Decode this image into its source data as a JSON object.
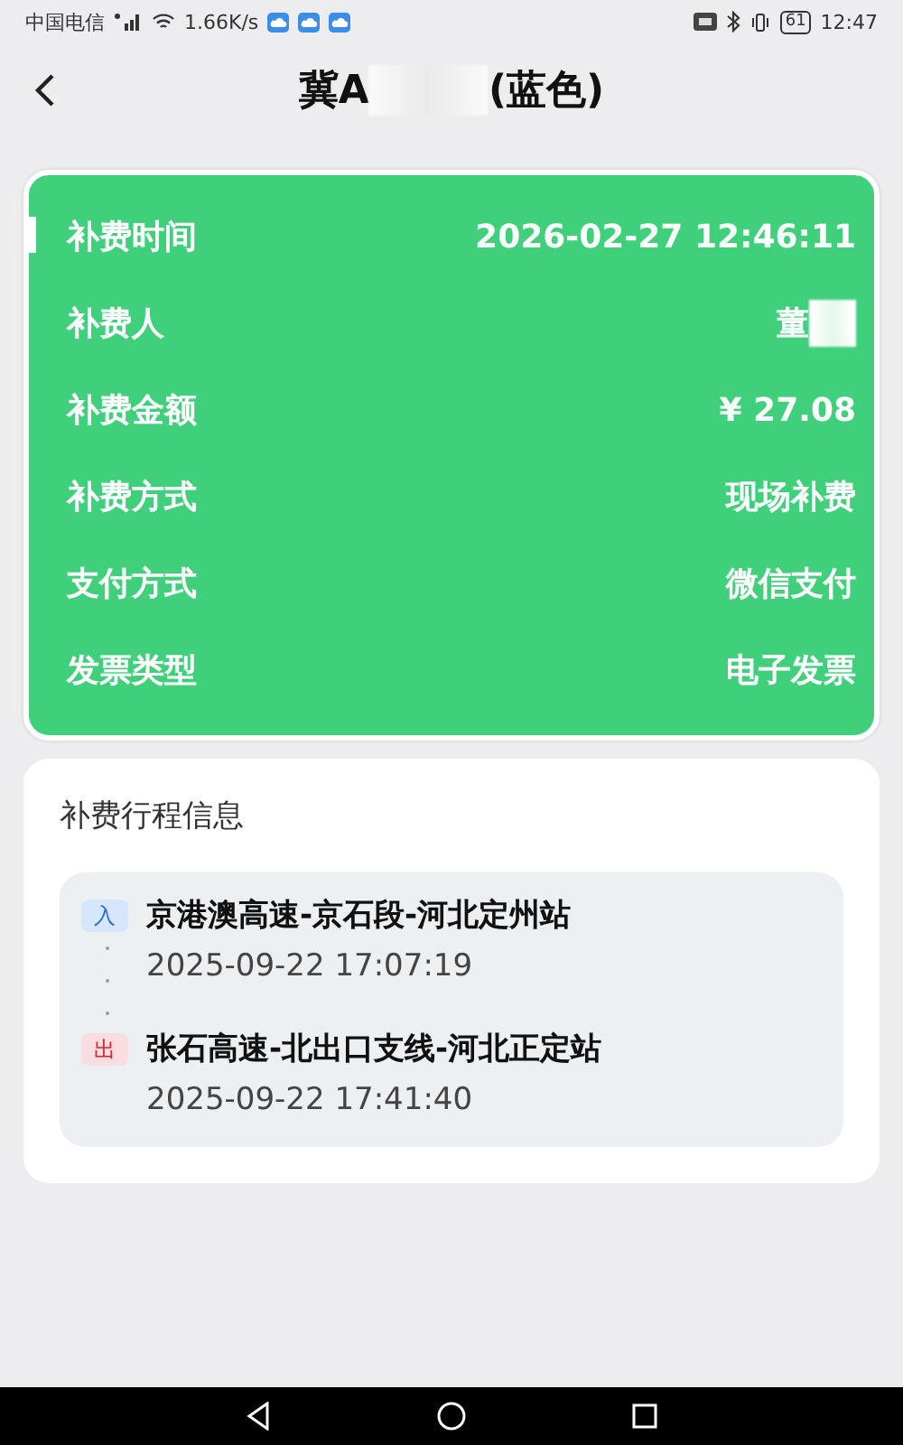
{
  "status_bar": {
    "carrier": "中国电信",
    "speed": "1.66K/s",
    "battery": "61",
    "time": "12:47"
  },
  "header": {
    "title_prefix": "冀A",
    "title_suffix": "(蓝色)",
    "title_masked": true
  },
  "summary": {
    "rows": [
      {
        "label": "补费时间",
        "value": "2026-02-27 12:46:11",
        "selected": true,
        "masked": false
      },
      {
        "label": "补费人",
        "value": "董",
        "selected": false,
        "masked": true
      },
      {
        "label": "补费金额",
        "value": "¥ 27.08",
        "selected": false,
        "masked": false
      },
      {
        "label": "补费方式",
        "value": "现场补费",
        "selected": false,
        "masked": false
      },
      {
        "label": "支付方式",
        "value": "微信支付",
        "selected": false,
        "masked": false
      },
      {
        "label": "发票类型",
        "value": "电子发票",
        "selected": false,
        "masked": false
      }
    ]
  },
  "trip": {
    "title": "补费行程信息",
    "stops": [
      {
        "kind": "entry",
        "tag": "入",
        "station": "京港澳高速-京石段-河北定州站",
        "time": "2025-09-22 17:07:19"
      },
      {
        "kind": "exit",
        "tag": "出",
        "station": "张石高速-北出口支线-河北正定站",
        "time": "2025-09-22 17:41:40"
      }
    ]
  }
}
